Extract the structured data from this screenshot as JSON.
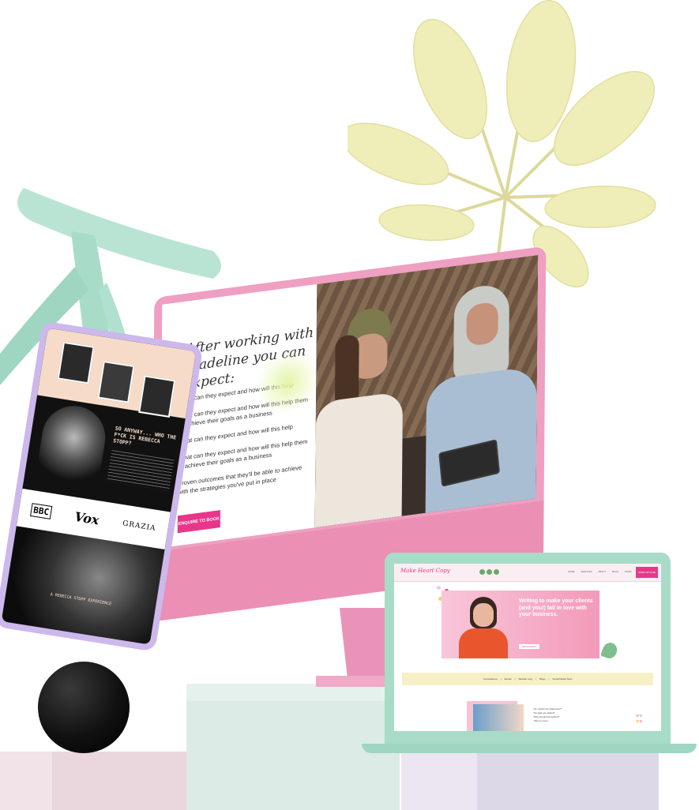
{
  "colors": {
    "monitor_pink": "#ef9fc1",
    "accent_pink": "#e8378b",
    "mint": "#a8dcc8",
    "lavender": "#cdb8ec",
    "leaf_yellow": "#efedb8",
    "pedestal_mint": "#dcebe6",
    "pedestal_pink": "#ead7dd",
    "pedestal_lavender": "#e6e0ee"
  },
  "monitor": {
    "heading_line1": "After working with",
    "heading_line2": "Madeline you can expect:",
    "bullets": [
      "What can they expect and how will this help",
      "What can they expect and how will this help them to achieve their goals as a business",
      "What can they expect and how will this help",
      "What can they expect and how will this help them to achieve their goals as a business",
      "Proven outcomes that they'll be able to achieve with the strategies you've put in place"
    ],
    "cta_label": "ENQUIRE TO BOOK"
  },
  "tablet": {
    "headline": "SO ANYWAY... WHO THE F*CK IS REBECCA STOPP?",
    "press_logos": [
      "BBC",
      "Vox",
      "GRAZIA"
    ],
    "bottom_caption": "A REBECCA STOPP EXPERIENCE"
  },
  "laptop": {
    "logo_text": "Make Heart Copy",
    "nav_items": [
      "HOME",
      "SERVICES",
      "ABOUT",
      "BLOG",
      "WORK"
    ],
    "nav_cta": "WORK WITH ME",
    "hero_headline": "Writing to make your clients (and you!) fall in love with your business.",
    "hero_cta": "GET IN TOUCH",
    "strip_items": [
      "Consultations",
      "Emails",
      "Website copy",
      "Blogs",
      "Social Media Tools"
    ],
    "quote_line1": "\"So, what's the difference?\"",
    "quote_line2": "\"So glad you asked!\"",
    "quote_line3": "\"Why should we bother?\"",
    "quote_line4": "\"Tell me more.\""
  }
}
